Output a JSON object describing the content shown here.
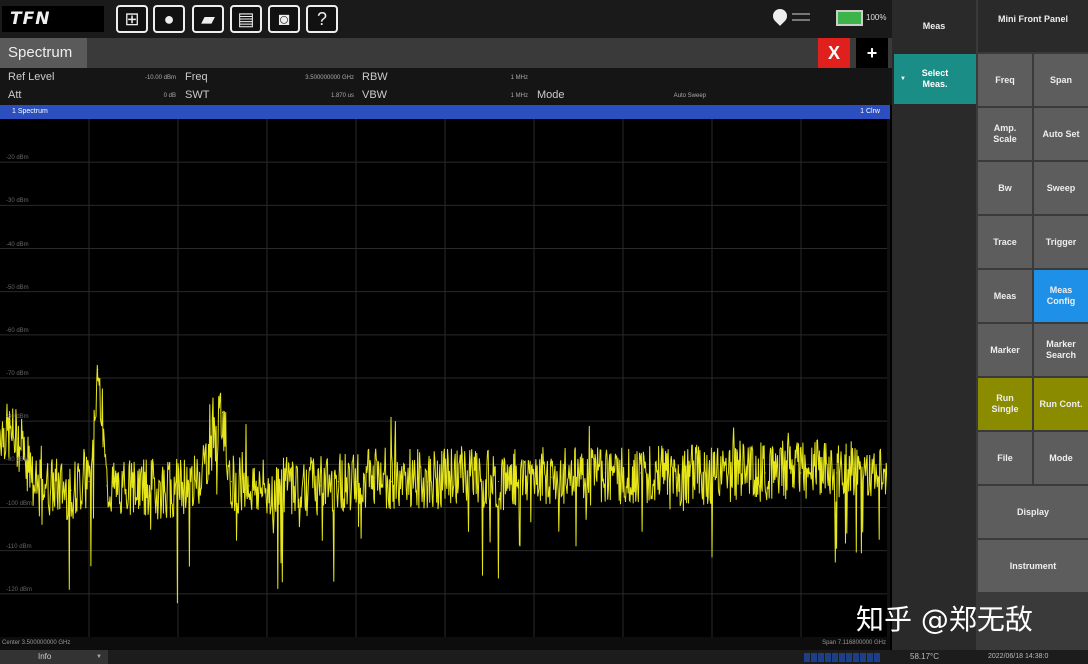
{
  "toolbar": {
    "logo": "TFN",
    "buttons": [
      {
        "name": "windows-icon",
        "glyph": "⊞"
      },
      {
        "name": "lightbulb-icon",
        "glyph": "●"
      },
      {
        "name": "folder-icon",
        "glyph": "▰"
      },
      {
        "name": "save-icon",
        "glyph": "▤"
      },
      {
        "name": "camera-icon",
        "glyph": "◙"
      },
      {
        "name": "help-icon",
        "glyph": "?"
      }
    ],
    "battery": "100%"
  },
  "tabs": {
    "active": "Spectrum",
    "close_label": "X",
    "add_label": "+"
  },
  "params": {
    "ref_level_label": "Ref Level",
    "ref_level_value": "-10.00 dBm",
    "att_label": "Att",
    "att_value": "0 dB",
    "freq_label": "Freq",
    "freq_value": "3.500000000 GHz",
    "swt_label": "SWT",
    "swt_value": "1.870 us",
    "rbw_label": "RBW",
    "rbw_value": "1 MHz",
    "vbw_label": "VBW",
    "vbw_value": "1 MHz",
    "mode_label": "Mode",
    "mode_value": "Auto Sweep"
  },
  "trace": {
    "title": "1 Spectrum",
    "mode": "1 Clrw"
  },
  "chart_data": {
    "type": "line",
    "title": "",
    "xlabel": "",
    "ylabel": "",
    "ylim": [
      -130,
      -10
    ],
    "y_ticks": [
      "-20 dBm",
      "-30 dBm",
      "-40 dBm",
      "-50 dBm",
      "-60 dBm",
      "-70 dBm",
      "-80 dBm",
      "-90 dBm",
      "-100 dBm",
      "-110 dBm",
      "-120 dBm"
    ],
    "y_tick_values": [
      -20,
      -30,
      -40,
      -50,
      -60,
      -70,
      -80,
      -90,
      -100,
      -110,
      -120
    ],
    "center": "Center  3.500000000 GHz",
    "span": "Span  7.116800000 GHz",
    "trace_color": "#e6e619",
    "series": [
      {
        "x": [
          0,
          0.02,
          0.04,
          0.06,
          0.08,
          0.1,
          0.11,
          0.12,
          0.14,
          0.16,
          0.18,
          0.2,
          0.22,
          0.24,
          0.25,
          0.26,
          0.28,
          0.3,
          0.32,
          0.34,
          0.36,
          0.38,
          0.4,
          0.42,
          0.44,
          0.46,
          0.48,
          0.5,
          0.52,
          0.54,
          0.56,
          0.58,
          0.6,
          0.62,
          0.64,
          0.66,
          0.68,
          0.7,
          0.72,
          0.74,
          0.76,
          0.78,
          0.8,
          0.82,
          0.84,
          0.86,
          0.88,
          0.9,
          0.92,
          0.94,
          0.96,
          0.98,
          1.0
        ],
        "y": [
          -82,
          -84,
          -96,
          -95,
          -96,
          -94,
          -68,
          -95,
          -96,
          -95,
          -96,
          -95,
          -94,
          -85,
          -78,
          -94,
          -95,
          -96,
          -95,
          -94,
          -95,
          -94,
          -94,
          -93,
          -94,
          -93,
          -94,
          -93,
          -92,
          -93,
          -94,
          -93,
          -92,
          -93,
          -92,
          -93,
          -92,
          -93,
          -92,
          -92,
          -93,
          -92,
          -93,
          -92,
          -91,
          -92,
          -91,
          -92,
          -91,
          -92,
          -91,
          -92,
          -92
        ]
      }
    ]
  },
  "side_mid": {
    "title": "Meas",
    "select": "Select Meas."
  },
  "side_right": {
    "mini": "Mini Front Panel",
    "buttons": [
      {
        "id": "freq",
        "label": "Freq"
      },
      {
        "id": "span",
        "label": "Span"
      },
      {
        "id": "amp",
        "label": "Amp. Scale"
      },
      {
        "id": "autoset",
        "label": "Auto Set"
      },
      {
        "id": "bw",
        "label": "Bw"
      },
      {
        "id": "sweep",
        "label": "Sweep"
      },
      {
        "id": "trace",
        "label": "Trace"
      },
      {
        "id": "trigger",
        "label": "Trigger"
      },
      {
        "id": "meas",
        "label": "Meas"
      },
      {
        "id": "measconfig",
        "label": "Meas Config"
      },
      {
        "id": "marker",
        "label": "Marker"
      },
      {
        "id": "markersearch",
        "label": "Marker Search"
      },
      {
        "id": "runsingle",
        "label": "Run Single"
      },
      {
        "id": "runcont",
        "label": "Run Cont."
      },
      {
        "id": "file",
        "label": "File"
      },
      {
        "id": "mode",
        "label": "Mode"
      },
      {
        "id": "display",
        "label": "Display"
      },
      {
        "id": "instrument",
        "label": "Instrument"
      }
    ]
  },
  "status": {
    "info": "Info",
    "temperature": "58.17°C",
    "datetime": "2022/06/18 14:38:0"
  },
  "watermark": "知乎 @郑无敌"
}
